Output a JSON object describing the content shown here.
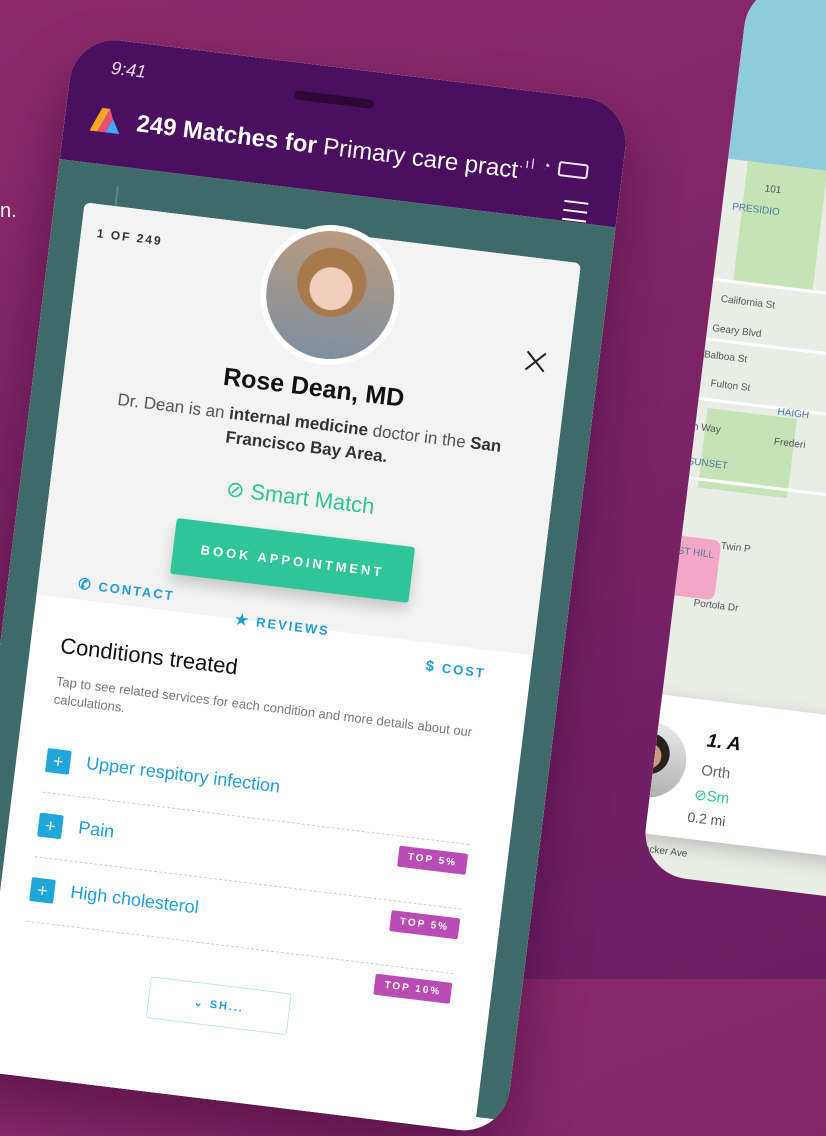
{
  "edge_text": "n.",
  "phone_main": {
    "status": {
      "time": "9:41",
      "signal": ".ıl",
      "wifi": "◔"
    },
    "header": {
      "title_bold": "249 Matches for",
      "title_query": "Primary care pract"
    },
    "card": {
      "counter": "1 OF 249",
      "doctor_name": "Rose Dean, MD",
      "desc_1": "Dr. Dean is an",
      "desc_bold_1": "internal medicine",
      "desc_2": "doctor in the",
      "desc_bold_2": "San Francisco Bay Area.",
      "smart_match": "Smart Match",
      "book_label": "BOOK APPOINTMENT",
      "actions": {
        "contact": "CONTACT",
        "reviews": "REVIEWS",
        "cost": "COST"
      },
      "conditions_title": "Conditions treated",
      "conditions_sub": "Tap to see related services for each condition and more details about our calculations.",
      "conditions": [
        {
          "label": "Upper respitory infection",
          "badge": "TOP 5%"
        },
        {
          "label": "Pain",
          "badge": "TOP 5%"
        },
        {
          "label": "High cholesterol",
          "badge": "TOP 10%"
        }
      ],
      "show_more": "SH..."
    }
  },
  "phone_map": {
    "map_labels": [
      "101",
      "PRESIDIO",
      "California St",
      "Geary Blvd",
      "Balboa St",
      "Fulton St",
      "Lin Way",
      "ER SUNSET",
      "FOREST HILL",
      "Portola Dr",
      "Twin P",
      "HAIGH",
      "Frederi",
      "Crocker Ave"
    ],
    "doctor": {
      "name": "1. A",
      "specialty": "Orth",
      "smart": "Sm",
      "distance": "0.2 mi"
    }
  },
  "colors": {
    "background": "#7d2466",
    "header": "#4a0f5e",
    "accent_green": "#2fc598",
    "accent_blue": "#1e9ed4",
    "badge_purple": "#b94bb4"
  }
}
